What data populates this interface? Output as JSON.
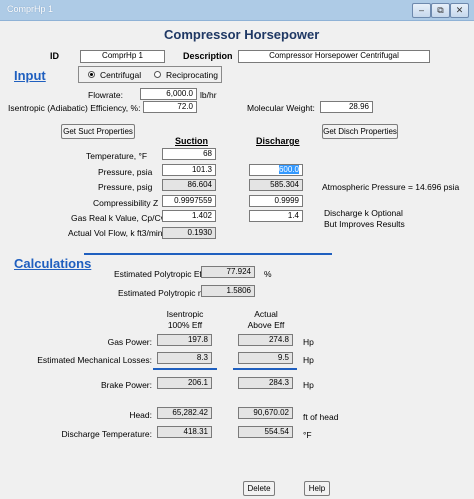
{
  "window": {
    "title": "ComprHp 1",
    "minimize": "–",
    "restore": "⧉",
    "close": "✕"
  },
  "header": {
    "title": "Compressor Horsepower",
    "id_label": "ID",
    "id_value": "ComprHp 1",
    "desc_label": "Description",
    "desc_value": "Compressor Horsepower Centrifugal"
  },
  "input": {
    "section": "Input",
    "radio_centrifugal": "Centrifugal",
    "radio_reciprocating": "Reciprocating",
    "flowrate_label": "Flowrate:",
    "flowrate_value": "6,000.0",
    "flowrate_unit": "lb/hr",
    "eff_label": "Isentropic (Adiabatic) Efficiency, %:",
    "eff_value": "72.0",
    "mw_label": "Molecular Weight:",
    "mw_value": "28.96",
    "suct_button": "Get Suct Properties",
    "disch_button": "Get Disch Properties",
    "suction_header": "Suction",
    "discharge_header": "Discharge",
    "temp_label": "Temperature,   °F",
    "temp_suction": "68",
    "psia_label": "Pressure,   psia",
    "psia_suction": "101.3",
    "psia_discharge": "600.0",
    "psig_label": "Pressure,   psig",
    "psig_suction": "86.604",
    "psig_discharge": "585.304",
    "atm_note": "Atmospheric Pressure = 14.696 psia",
    "z_label": "Compressibility Z",
    "z_suction": "0.9997559",
    "z_discharge": "0.9999",
    "k_label": "Gas Real k Value, Cp/Cv",
    "k_suction": "1.402",
    "k_discharge": "1.4",
    "k_note1": "Discharge k Optional",
    "k_note2": "But Improves Results",
    "flow_label": "Actual Vol Flow,",
    "flow_unit": "k ft3/min",
    "flow_value": "0.1930"
  },
  "calc": {
    "section": "Calculations",
    "poly_eff_label": "Estimated Polytropic Eff:",
    "poly_eff_value": "77.924",
    "poly_eff_unit": "%",
    "poly_n_label": "Estimated Polytropic n:",
    "poly_n_value": "1.5806",
    "col1_a": "Isentropic",
    "col1_b": "100% Eff",
    "col2_a": "Actual",
    "col2_b": "Above Eff",
    "gas_power_label": "Gas Power:",
    "gas_power_1": "197.8",
    "gas_power_2": "274.8",
    "hp1": "Hp",
    "mech_label": "Estimated Mechanical Losses:",
    "mech_1": "8.3",
    "mech_2": "9.5",
    "hp2": "Hp",
    "brake_label": "Brake Power:",
    "brake_1": "206.1",
    "brake_2": "284.3",
    "hp3": "Hp",
    "head_label": "Head:",
    "head_1": "65,282.42",
    "head_2": "90,670.02",
    "head_unit": "ft of head",
    "dtemp_label": "Discharge Temperature:",
    "dtemp_1": "418.31",
    "dtemp_2": "554.54",
    "dtemp_unit": "°F"
  },
  "footer": {
    "delete": "Delete",
    "help": "Help"
  },
  "colors": {
    "accent": "#1f5fbf",
    "title": "#1f3864",
    "selection": "#3399ff"
  }
}
